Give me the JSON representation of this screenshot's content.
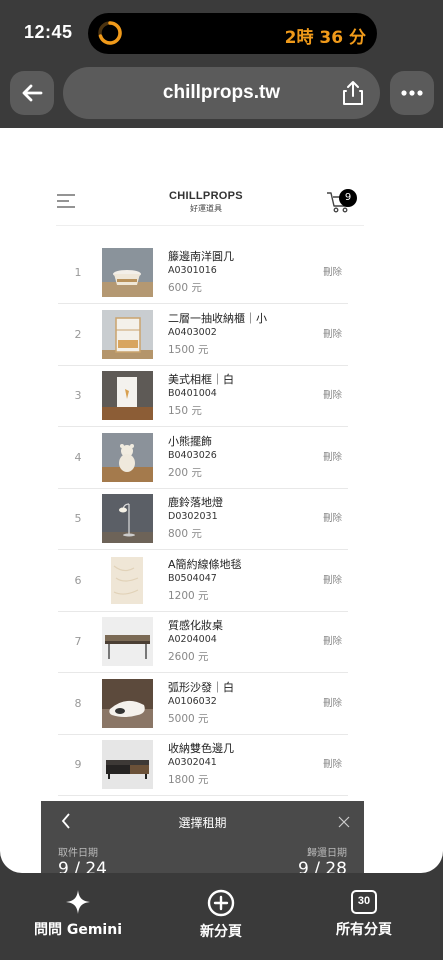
{
  "status": {
    "time": "12:45",
    "timer": "2時 36 分"
  },
  "browser": {
    "url": "chillprops.tw"
  },
  "site": {
    "brand": "CHILLPROPS",
    "brand_sub": "好運道具",
    "cart_count": "9"
  },
  "cart": {
    "delete_label": "刪除",
    "items": [
      {
        "index": "1",
        "name": "籐邊南洋圓几",
        "code": "A0301016",
        "price": "600 元"
      },
      {
        "index": "2",
        "name": "二層一抽收納櫃｜小",
        "code": "A0403002",
        "price": "1500 元"
      },
      {
        "index": "3",
        "name": "美式相框｜白",
        "code": "B0401004",
        "price": "150 元"
      },
      {
        "index": "4",
        "name": "小熊擺飾",
        "code": "B0403026",
        "price": "200 元"
      },
      {
        "index": "5",
        "name": "鹿鈴落地燈",
        "code": "D0302031",
        "price": "800 元"
      },
      {
        "index": "6",
        "name": "A簡約線條地毯",
        "code": "B0504047",
        "price": "1200 元"
      },
      {
        "index": "7",
        "name": "質感化妝桌",
        "code": "A0204004",
        "price": "2600 元"
      },
      {
        "index": "8",
        "name": "弧形沙發｜白",
        "code": "A0106032",
        "price": "5000 元"
      },
      {
        "index": "9",
        "name": "收納雙色邊几",
        "code": "A0302041",
        "price": "1800 元"
      }
    ]
  },
  "rental": {
    "title": "選擇租期",
    "pickup_label": "取件日期",
    "return_label": "歸還日期",
    "pickup_date": "9 / 24",
    "return_date": "9 / 28"
  },
  "toolbar": {
    "gemini": "問問 Gemini",
    "new_tab": "新分頁",
    "all_tabs": "所有分頁",
    "tab_count": "30"
  }
}
